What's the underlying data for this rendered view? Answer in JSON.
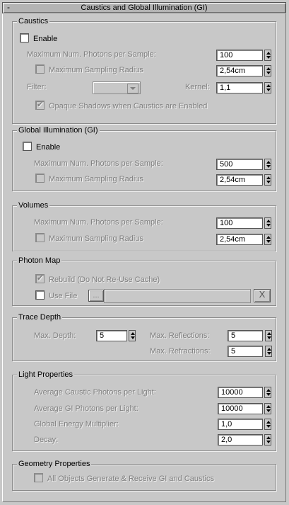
{
  "rollout": {
    "collapse_glyph": "-",
    "title": "Caustics and Global Illumination (GI)"
  },
  "caustics": {
    "title": "Caustics",
    "enable_label": "Enable",
    "enable_checked": false,
    "max_photons_label": "Maximum Num. Photons per Sample:",
    "max_photons_value": "100",
    "max_radius_label": "Maximum Sampling Radius",
    "max_radius_checked": false,
    "max_radius_value": "2,54cm",
    "filter_label": "Filter:",
    "filter_value": "",
    "kernel_label": "Kernel:",
    "kernel_value": "1,1",
    "opaque_label": "Opaque Shadows when Caustics are Enabled",
    "opaque_checked": true
  },
  "gi": {
    "title": "Global Illumination (GI)",
    "enable_label": "Enable",
    "enable_checked": false,
    "max_photons_label": "Maximum Num. Photons per Sample:",
    "max_photons_value": "500",
    "max_radius_label": "Maximum Sampling Radius",
    "max_radius_checked": false,
    "max_radius_value": "2,54cm"
  },
  "volumes": {
    "title": "Volumes",
    "max_photons_label": "Maximum Num. Photons per Sample:",
    "max_photons_value": "100",
    "max_radius_label": "Maximum Sampling Radius",
    "max_radius_checked": false,
    "max_radius_value": "2,54cm"
  },
  "photon_map": {
    "title": "Photon Map",
    "rebuild_label": "Rebuild (Do Not Re-Use Cache)",
    "rebuild_checked": true,
    "use_file_label": "Use File",
    "use_file_checked": false,
    "browse_label": "...",
    "file_value": "",
    "clear_label": "X"
  },
  "trace_depth": {
    "title": "Trace Depth",
    "max_depth_label": "Max. Depth:",
    "max_depth_value": "5",
    "max_reflections_label": "Max. Reflections:",
    "max_reflections_value": "5",
    "max_refractions_label": "Max. Refractions:",
    "max_refractions_value": "5"
  },
  "light_properties": {
    "title": "Light Properties",
    "avg_caustic_label": "Average Caustic Photons per Light:",
    "avg_caustic_value": "10000",
    "avg_gi_label": "Average GI Photons per Light:",
    "avg_gi_value": "10000",
    "energy_label": "Global Energy Multiplier:",
    "energy_value": "1,0",
    "decay_label": "Decay:",
    "decay_value": "2,0"
  },
  "geometry": {
    "title": "Geometry Properties",
    "all_objects_label": "All Objects Generate & Receive GI and Caustics",
    "all_objects_checked": false
  },
  "colors": {
    "panel_bg": "#c8c8c8",
    "disabled_text": "#7f7f7f"
  }
}
